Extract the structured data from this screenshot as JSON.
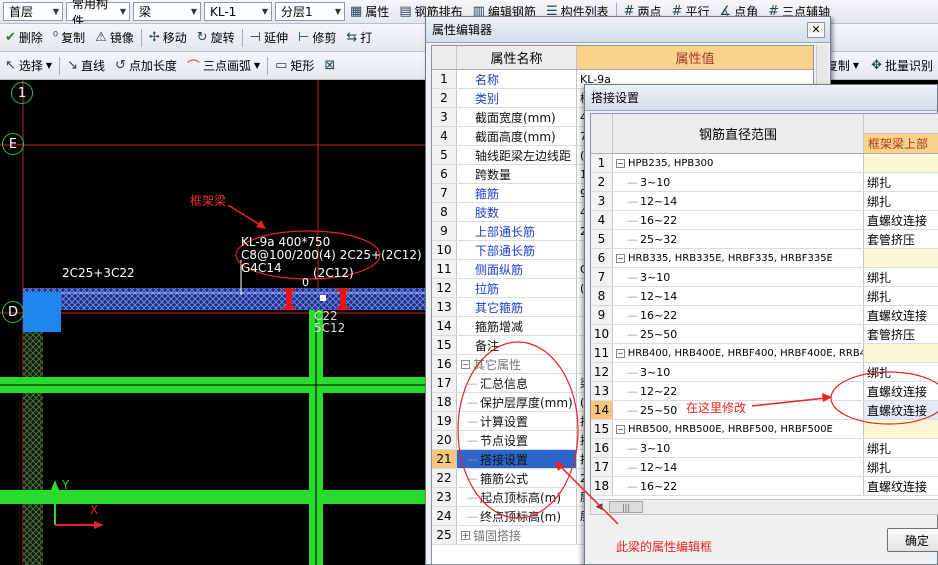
{
  "toolbar1": {
    "floor": "首层",
    "component_type": "常用构件",
    "component": "梁",
    "component_name": "KL-1",
    "layer": "分层1",
    "buttons": [
      "属性",
      "钢筋排布",
      "编辑钢筋",
      "构件列表",
      "两点",
      "平行",
      "点角",
      "三点辅轴"
    ]
  },
  "toolbar2": {
    "buttons": [
      "删除",
      "复制",
      "镜像",
      "移动",
      "旋转",
      "延伸",
      "修剪",
      "打"
    ]
  },
  "toolbar3": {
    "buttons": [
      "选择",
      "直线",
      "点加长度",
      "三点画弧",
      "矩形"
    ],
    "right_buttons": [
      "复制",
      "批量识别"
    ]
  },
  "canvas": {
    "axis_labels": [
      "1",
      "E",
      "D"
    ],
    "annotation_beam": "框架梁",
    "beam_text_line1": "KL-9a 400*750",
    "beam_text_line2": "C8@100/200(4) 2C25+(2C12)",
    "beam_text_line3": "G4C14",
    "left_rebar": "2C25+3C22",
    "mid_rebar": "(2C12)",
    "rebar_b1": "C22",
    "rebar_b2": "5C12",
    "origin_y": "Y",
    "origin_x": "X",
    "small_label": "0"
  },
  "prop_editor": {
    "title": "属性编辑器",
    "col_name": "属性名称",
    "col_value": "属性值",
    "rows": [
      {
        "num": "1",
        "name": "名称",
        "value": "KL-9a",
        "style": "blue"
      },
      {
        "num": "2",
        "name": "类别",
        "value": "楼",
        "style": "blue"
      },
      {
        "num": "3",
        "name": "截面宽度(mm)",
        "value": "4",
        "style": "black"
      },
      {
        "num": "4",
        "name": "截面高度(mm)",
        "value": "7",
        "style": "black"
      },
      {
        "num": "5",
        "name": "轴线距梁左边线距",
        "value": "(",
        "style": "black"
      },
      {
        "num": "6",
        "name": "跨数量",
        "value": "1",
        "style": "black"
      },
      {
        "num": "7",
        "name": "箍筋",
        "value": "9",
        "style": "blue"
      },
      {
        "num": "8",
        "name": "肢数",
        "value": "4",
        "style": "blue"
      },
      {
        "num": "9",
        "name": "上部通长筋",
        "value": "2",
        "style": "blue"
      },
      {
        "num": "10",
        "name": "下部通长筋",
        "value": "",
        "style": "blue"
      },
      {
        "num": "11",
        "name": "侧面纵筋",
        "value": "G",
        "style": "blue"
      },
      {
        "num": "12",
        "name": "拉筋",
        "value": "(",
        "style": "blue"
      },
      {
        "num": "13",
        "name": "其它箍筋",
        "value": "",
        "style": "blue"
      },
      {
        "num": "14",
        "name": "箍筋增减",
        "value": "",
        "style": "black"
      },
      {
        "num": "15",
        "name": "备注",
        "value": "",
        "style": "black"
      },
      {
        "num": "16",
        "name": "其它属性",
        "value": "",
        "style": "gray"
      },
      {
        "num": "17",
        "name": "汇总信息",
        "value": "梁",
        "style": "child"
      },
      {
        "num": "18",
        "name": "保护层厚度(mm)",
        "value": "(",
        "style": "child"
      },
      {
        "num": "19",
        "name": "计算设置",
        "value": "按",
        "style": "child"
      },
      {
        "num": "20",
        "name": "节点设置",
        "value": "按",
        "style": "child"
      },
      {
        "num": "21",
        "name": "搭接设置",
        "value": "按",
        "style": "child"
      },
      {
        "num": "22",
        "name": "箍筋公式",
        "value": "2",
        "style": "child"
      },
      {
        "num": "23",
        "name": "起点顶标高(m)",
        "value": "层",
        "style": "child"
      },
      {
        "num": "24",
        "name": "终点顶标高(m)",
        "value": "层",
        "style": "child"
      },
      {
        "num": "25",
        "name": "锚固搭接",
        "value": "",
        "style": "gray"
      }
    ]
  },
  "splice_dialog": {
    "title": "搭接设置",
    "col_range": "钢筋直径范围",
    "col_value": "框架梁上部",
    "rows": [
      {
        "num": "1",
        "range": "HPB235, HPB300",
        "value": "",
        "group": true
      },
      {
        "num": "2",
        "range": "3~10",
        "value": "绑扎",
        "group": false
      },
      {
        "num": "3",
        "range": "12~14",
        "value": "绑扎",
        "group": false
      },
      {
        "num": "4",
        "range": "16~22",
        "value": "直螺纹连接",
        "group": false
      },
      {
        "num": "5",
        "range": "25~32",
        "value": "套管挤压",
        "group": false
      },
      {
        "num": "6",
        "range": "HRB335, HRB335E, HRBF335, HRBF335E",
        "value": "",
        "group": true
      },
      {
        "num": "7",
        "range": "3~10",
        "value": "绑扎",
        "group": false
      },
      {
        "num": "8",
        "range": "12~14",
        "value": "绑扎",
        "group": false
      },
      {
        "num": "9",
        "range": "16~22",
        "value": "直螺纹连接",
        "group": false
      },
      {
        "num": "10",
        "range": "25~50",
        "value": "套管挤压",
        "group": false
      },
      {
        "num": "11",
        "range": "HRB400, HRB400E, HRBF400, HRBF400E, RRB400",
        "value": "",
        "group": true
      },
      {
        "num": "12",
        "range": "3~10",
        "value": "绑扎",
        "group": false
      },
      {
        "num": "13",
        "range": "12~22",
        "value": "直螺纹连接",
        "group": false
      },
      {
        "num": "14",
        "range": "25~50",
        "value": "直螺纹连接",
        "group": false
      },
      {
        "num": "15",
        "range": "HRB500, HRB500E, HRBF500, HRBF500E",
        "value": "",
        "group": true
      },
      {
        "num": "16",
        "range": "3~10",
        "value": "绑扎",
        "group": false
      },
      {
        "num": "17",
        "range": "12~14",
        "value": "绑扎",
        "group": false
      },
      {
        "num": "18",
        "range": "16~22",
        "value": "直螺纹连接",
        "group": false
      }
    ],
    "ok_label": "确定"
  },
  "annotations": {
    "modify_here": "在这里修改",
    "beam_prop_editor": "此梁的属性编辑框"
  }
}
